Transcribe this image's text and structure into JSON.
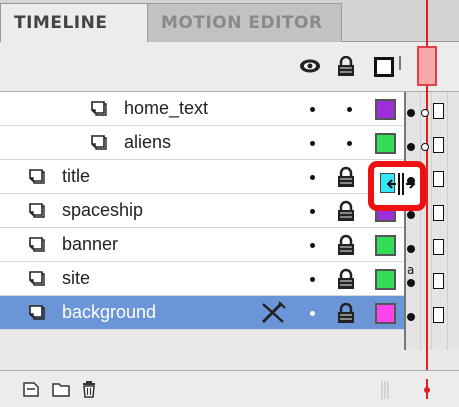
{
  "tabs": [
    {
      "label": "TIMELINE",
      "active": true
    },
    {
      "label": "MOTION EDITOR",
      "active": false
    }
  ],
  "header_icons": [
    "eye-icon",
    "lock-icon",
    "outline-icon"
  ],
  "layers": [
    {
      "name": "home_text",
      "indent": 2,
      "color": "#9b30d9",
      "locked": false,
      "selected": false
    },
    {
      "name": "aliens",
      "indent": 2,
      "color": "#33dd55",
      "locked": false,
      "selected": false
    },
    {
      "name": "title",
      "indent": 1,
      "color": "#35e8f5",
      "locked": true,
      "selected": false
    },
    {
      "name": "spaceship",
      "indent": 1,
      "color": "#9b30d9",
      "locked": true,
      "selected": false
    },
    {
      "name": "banner",
      "indent": 1,
      "color": "#33dd55",
      "locked": true,
      "selected": false
    },
    {
      "name": "site",
      "indent": 1,
      "color": "#33dd55",
      "locked": true,
      "selected": false
    },
    {
      "name": "background",
      "indent": 1,
      "color": "#ff44ee",
      "locked": true,
      "selected": true
    }
  ],
  "site_frame_label": "a",
  "bottom_icons": [
    "new-layer-icon",
    "new-folder-icon",
    "delete-layer-icon"
  ],
  "colors": {
    "playhead": "#e02020",
    "selection": "#6a95d6",
    "highlight": "#ee1111"
  }
}
